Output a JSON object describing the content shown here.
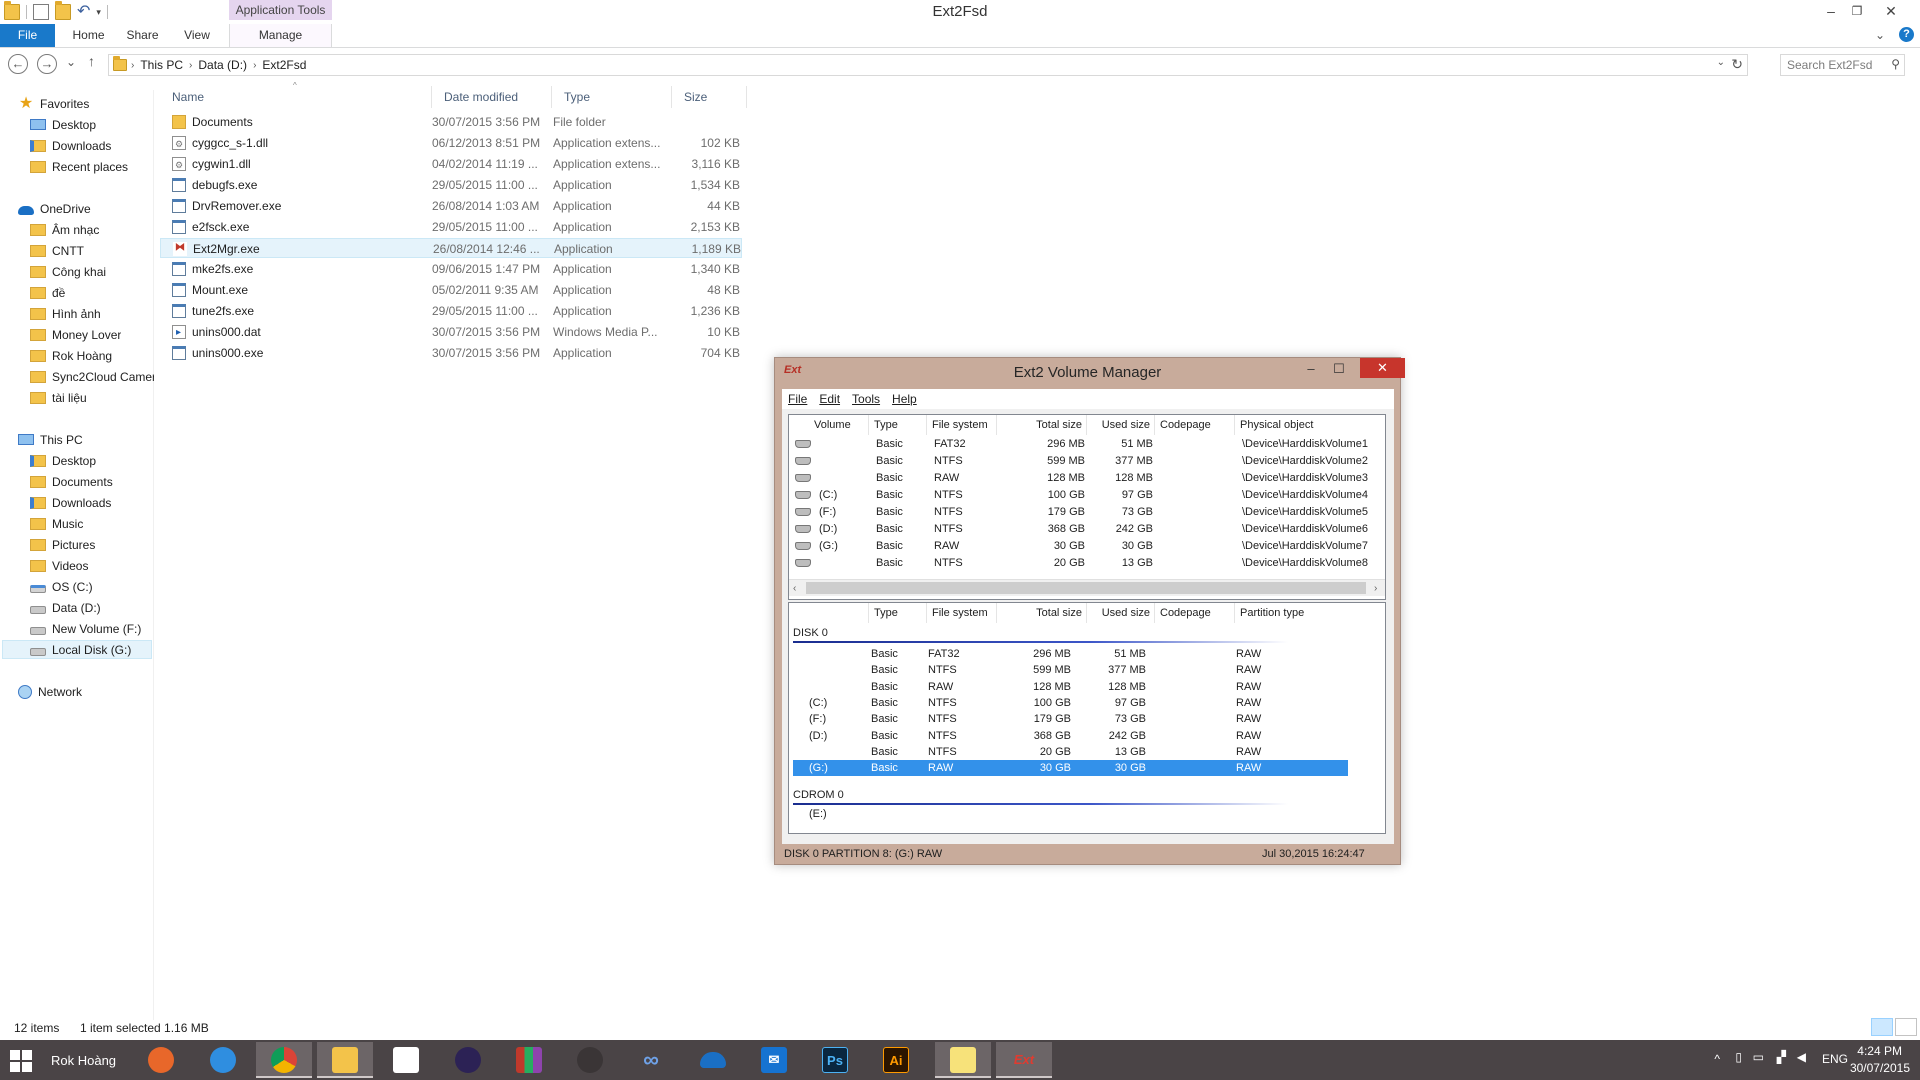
{
  "window": {
    "title": "Ext2Fsd",
    "context_tab": "Application Tools",
    "minimize": "–",
    "restore": "❐",
    "close": "✕"
  },
  "ribbon": {
    "tabs": [
      "File",
      "Home",
      "Share",
      "View",
      "Manage"
    ],
    "expand": "⌄",
    "help": "?"
  },
  "address_bar": {
    "back": "←",
    "forward": "→",
    "recent": "⌄",
    "up": "↑",
    "crumbs": [
      "This PC",
      "Data (D:)",
      "Ext2Fsd"
    ],
    "crumb_sep": "›",
    "search_placeholder": "Search Ext2Fsd",
    "search_icon": "⚲"
  },
  "nav_pane": {
    "favorites": {
      "label": "Favorites",
      "items": [
        "Desktop",
        "Downloads",
        "Recent places"
      ]
    },
    "onedrive": {
      "label": "OneDrive",
      "items": [
        "Âm nhạc",
        "CNTT",
        "Công khai",
        "đề",
        "Hình ảnh",
        "Money Lover",
        "Rok Hoàng",
        "Sync2Cloud Camer",
        "tài liệu"
      ]
    },
    "this_pc": {
      "label": "This PC",
      "items": [
        "Desktop",
        "Documents",
        "Downloads",
        "Music",
        "Pictures",
        "Videos",
        "OS (C:)",
        "Data (D:)",
        "New Volume (F:)",
        "Local Disk (G:)"
      ]
    },
    "network": {
      "label": "Network"
    }
  },
  "file_list": {
    "columns": [
      "Name",
      "Date modified",
      "Type",
      "Size"
    ],
    "sort_indicator": "^",
    "rows": [
      {
        "name": "Documents",
        "date": "30/07/2015 3:56 PM",
        "type": "File folder",
        "size": "",
        "icon": "folder-icon"
      },
      {
        "name": "cyggcc_s-1.dll",
        "date": "06/12/2013 8:51 PM",
        "type": "Application extens...",
        "size": "102 KB",
        "icon": "dll-icon"
      },
      {
        "name": "cygwin1.dll",
        "date": "04/02/2014 11:19 ...",
        "type": "Application extens...",
        "size": "3,116 KB",
        "icon": "dll-icon"
      },
      {
        "name": "debugfs.exe",
        "date": "29/05/2015 11:00 ...",
        "type": "Application",
        "size": "1,534 KB",
        "icon": "exe-icon"
      },
      {
        "name": "DrvRemover.exe",
        "date": "26/08/2014 1:03 AM",
        "type": "Application",
        "size": "44 KB",
        "icon": "exe-icon"
      },
      {
        "name": "e2fsck.exe",
        "date": "29/05/2015 11:00 ...",
        "type": "Application",
        "size": "2,153 KB",
        "icon": "exe-icon"
      },
      {
        "name": "Ext2Mgr.exe",
        "date": "26/08/2014 12:46 ...",
        "type": "Application",
        "size": "1,189 KB",
        "icon": "ext2-icon"
      },
      {
        "name": "mke2fs.exe",
        "date": "09/06/2015 1:47 PM",
        "type": "Application",
        "size": "1,340 KB",
        "icon": "exe-icon"
      },
      {
        "name": "Mount.exe",
        "date": "05/02/2011 9:35 AM",
        "type": "Application",
        "size": "48 KB",
        "icon": "exe-icon"
      },
      {
        "name": "tune2fs.exe",
        "date": "29/05/2015 11:00 ...",
        "type": "Application",
        "size": "1,236 KB",
        "icon": "exe-icon"
      },
      {
        "name": "unins000.dat",
        "date": "30/07/2015 3:56 PM",
        "type": "Windows Media P...",
        "size": "10 KB",
        "icon": "media-file-icon"
      },
      {
        "name": "unins000.exe",
        "date": "30/07/2015 3:56 PM",
        "type": "Application",
        "size": "704 KB",
        "icon": "installer-icon"
      }
    ],
    "selected_index": 6
  },
  "status_bar": {
    "item_count": "12 items",
    "selection": "1 item selected  1.16 MB"
  },
  "ext2_manager": {
    "title": "Ext2 Volume Manager",
    "logo": "Ext",
    "min": "–",
    "max": "☐",
    "close": "✕",
    "menu": [
      "File",
      "Edit",
      "Tools",
      "Help"
    ],
    "volume_columns": [
      "Volume",
      "Type",
      "File system",
      "Total size",
      "Used size",
      "Codepage",
      "Physical object"
    ],
    "volumes": [
      {
        "volume": "",
        "type": "Basic",
        "fs": "FAT32",
        "total": "296 MB",
        "used": "51 MB",
        "codepage": "",
        "physical": "\\Device\\HarddiskVolume1"
      },
      {
        "volume": "",
        "type": "Basic",
        "fs": "NTFS",
        "total": "599 MB",
        "used": "377 MB",
        "codepage": "",
        "physical": "\\Device\\HarddiskVolume2"
      },
      {
        "volume": "",
        "type": "Basic",
        "fs": "RAW",
        "total": "128 MB",
        "used": "128 MB",
        "codepage": "",
        "physical": "\\Device\\HarddiskVolume3"
      },
      {
        "volume": "(C:)",
        "type": "Basic",
        "fs": "NTFS",
        "total": "100 GB",
        "used": "97 GB",
        "codepage": "",
        "physical": "\\Device\\HarddiskVolume4"
      },
      {
        "volume": "(F:)",
        "type": "Basic",
        "fs": "NTFS",
        "total": "179 GB",
        "used": "73 GB",
        "codepage": "",
        "physical": "\\Device\\HarddiskVolume5"
      },
      {
        "volume": "(D:)",
        "type": "Basic",
        "fs": "NTFS",
        "total": "368 GB",
        "used": "242 GB",
        "codepage": "",
        "physical": "\\Device\\HarddiskVolume6"
      },
      {
        "volume": "(G:)",
        "type": "Basic",
        "fs": "RAW",
        "total": "30 GB",
        "used": "30 GB",
        "codepage": "",
        "physical": "\\Device\\HarddiskVolume7"
      },
      {
        "volume": "",
        "type": "Basic",
        "fs": "NTFS",
        "total": "20 GB",
        "used": "13 GB",
        "codepage": "",
        "physical": "\\Device\\HarddiskVolume8"
      }
    ],
    "scroll_left": "‹",
    "scroll_right": "›",
    "disk_columns": [
      "",
      "Type",
      "File system",
      "Total size",
      "Used size",
      "Codepage",
      "Partition type"
    ],
    "disk0_label": "DISK 0",
    "disk0_partitions": [
      {
        "volume": "",
        "type": "Basic",
        "fs": "FAT32",
        "total": "296 MB",
        "used": "51 MB",
        "ptype": "RAW"
      },
      {
        "volume": "",
        "type": "Basic",
        "fs": "NTFS",
        "total": "599 MB",
        "used": "377 MB",
        "ptype": "RAW"
      },
      {
        "volume": "",
        "type": "Basic",
        "fs": "RAW",
        "total": "128 MB",
        "used": "128 MB",
        "ptype": "RAW"
      },
      {
        "volume": "(C:)",
        "type": "Basic",
        "fs": "NTFS",
        "total": "100 GB",
        "used": "97 GB",
        "ptype": "RAW"
      },
      {
        "volume": "(F:)",
        "type": "Basic",
        "fs": "NTFS",
        "total": "179 GB",
        "used": "73 GB",
        "ptype": "RAW"
      },
      {
        "volume": "(D:)",
        "type": "Basic",
        "fs": "NTFS",
        "total": "368 GB",
        "used": "242 GB",
        "ptype": "RAW"
      },
      {
        "volume": "",
        "type": "Basic",
        "fs": "NTFS",
        "total": "20 GB",
        "used": "13 GB",
        "ptype": "RAW"
      },
      {
        "volume": "(G:)",
        "type": "Basic",
        "fs": "RAW",
        "total": "30 GB",
        "used": "30 GB",
        "ptype": "RAW"
      }
    ],
    "disk0_selected_index": 7,
    "cdrom_label": "CDROM 0",
    "cdrom_volume": "(E:)",
    "status_left": "DISK 0 PARTITION 8: (G:) RAW",
    "status_right": "Jul 30,2015 16:24:47"
  },
  "taskbar": {
    "user": "Rok Hoàng",
    "apps": [
      "Firefox",
      "Internet Explorer",
      "Chrome",
      "File Explorer",
      "Calculator",
      "Eclipse",
      "WinRAR",
      "GitHub",
      "Infinity",
      "OneDrive",
      "Mail",
      "Photoshop",
      "Illustrator",
      "Sticky Notes",
      "Ext2 Volume Manager"
    ],
    "ps_label": "Ps",
    "ai_label": "Ai",
    "ext_label": "Ext",
    "tray_caret": "^",
    "lang": "ENG",
    "time": "4:24 PM",
    "date": "30/07/2015"
  }
}
